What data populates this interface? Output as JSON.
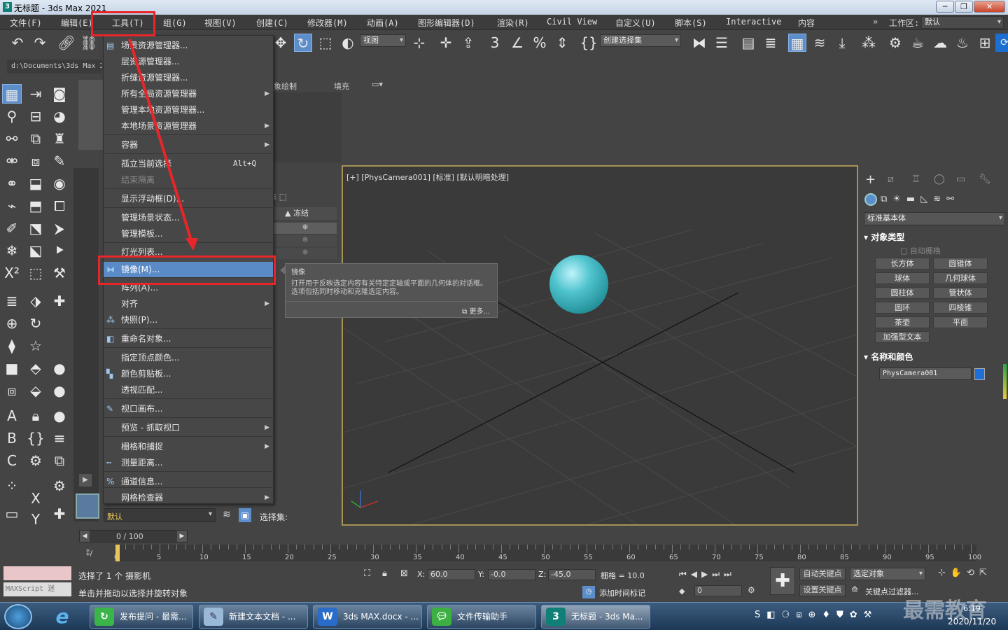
{
  "window": {
    "title": "无标题 - 3ds Max 2021",
    "logo": "3"
  },
  "menubar": {
    "items": [
      "文件(F)",
      "编辑(E)",
      "工具(T)",
      "组(G)",
      "视图(V)",
      "创建(C)",
      "修改器(M)",
      "动画(A)",
      "图形编辑器(D)",
      "渲染(R)",
      "Civil View",
      "自定义(U)",
      "脚本(S)",
      "Interactive",
      "内容"
    ],
    "workspace_label": "工作区:",
    "workspace_value": "默认"
  },
  "toolbar": {
    "view_dropdown": "视图",
    "selection_set": "创建选择集"
  },
  "path": "d:\\Documents\\3ds Max 2",
  "ribbon": {
    "paint": "象绘制",
    "fill": "填充"
  },
  "scene": {
    "freeze_header": "▲ 冻结"
  },
  "tools_menu": {
    "items": [
      {
        "label": "场景资源管理器...",
        "icon": "scene-explorer-icon"
      },
      {
        "label": "层资源管理器...",
        "icon": ""
      },
      {
        "label": "折缝资源管理器...",
        "icon": ""
      },
      {
        "label": "所有全局资源管理器",
        "icon": "",
        "submenu": true
      },
      {
        "label": "管理本地资源管理器...",
        "icon": ""
      },
      {
        "label": "本地场景资源管理器",
        "icon": "",
        "submenu": true
      },
      {
        "label": "容器",
        "icon": "",
        "submenu": true
      },
      {
        "label": "孤立当前选择",
        "icon": "",
        "shortcut": "Alt+Q"
      },
      {
        "label": "结束隔离",
        "icon": "",
        "disabled": true
      },
      {
        "label": "显示浮动框(D)...",
        "icon": ""
      },
      {
        "label": "管理场景状态...",
        "icon": ""
      },
      {
        "label": "管理模板...",
        "icon": ""
      },
      {
        "label": "灯光列表...",
        "icon": ""
      },
      {
        "label": "镜像(M)...",
        "icon": "mirror-icon",
        "highlighted": true
      },
      {
        "label": "阵列(A)...",
        "icon": ""
      },
      {
        "label": "对齐",
        "icon": "",
        "submenu": true
      },
      {
        "label": "快照(P)...",
        "icon": "snapshot-icon"
      },
      {
        "label": "重命名对象...",
        "icon": "rename-icon"
      },
      {
        "label": "指定顶点颜色...",
        "icon": ""
      },
      {
        "label": "颜色剪贴板...",
        "icon": "color-clipboard-icon"
      },
      {
        "label": "透视匹配...",
        "icon": ""
      },
      {
        "label": "视口画布...",
        "icon": "brush-icon"
      },
      {
        "label": "预览 - 抓取视口",
        "icon": "",
        "submenu": true
      },
      {
        "label": "栅格和捕捉",
        "icon": "",
        "submenu": true
      },
      {
        "label": "测量距离...",
        "icon": "measure-icon"
      },
      {
        "label": "通道信息...",
        "icon": "channel-icon"
      },
      {
        "label": "网格检查器",
        "icon": "",
        "submenu": true
      }
    ]
  },
  "tooltip": {
    "title": "镜像",
    "desc": "打开用于反映选定内容有关特定定轴或平面的几何体的对话框。选项包括同时移动和克隆选定内容。",
    "more": "更多..."
  },
  "viewport": {
    "label": "[+] [PhysCamera001] [标准] [默认明暗处理]"
  },
  "command_panel": {
    "category": "标准基本体",
    "object_type_title": "对象类型",
    "autogrid": "自动栅格",
    "buttons": [
      "长方体",
      "圆锥体",
      "球体",
      "几何球体",
      "圆柱体",
      "管状体",
      "圆环",
      "四棱锥",
      "茶壶",
      "平面"
    ],
    "extra": "加强型文本",
    "name_color_title": "名称和颜色",
    "object_name": "PhysCamera001",
    "object_color": "#1e6fd8"
  },
  "layer_bar": {
    "layer": "默认",
    "selection_set": "选择集:"
  },
  "timeline": {
    "frame": "0 / 100",
    "ticks": [
      "0",
      "5",
      "10",
      "15",
      "20",
      "25",
      "30",
      "35",
      "40",
      "45",
      "50",
      "55",
      "60",
      "65",
      "70",
      "75",
      "80",
      "85",
      "90",
      "95",
      "100"
    ]
  },
  "status": {
    "selected": "选择了 1 个 摄影机",
    "hint": "单击并拖动以选择并旋转对象",
    "maxscript": "MAXScript 迷",
    "x_label": "X:",
    "x": "60.0",
    "y_label": "Y:",
    "y": "-0.0",
    "z_label": "Z:",
    "z": "-45.0",
    "grid": "栅格 = 10.0",
    "add_time_tag": "添加时间标记",
    "auto_key": "自动关键点",
    "set_key": "设置关键点",
    "selected_obj": "选定对象",
    "key_filter": "关键点过滤器...",
    "frame_field": "0"
  },
  "taskbar": {
    "tasks": [
      "发布提问 - 最需...",
      "新建文本文档 - ...",
      "3ds MAX.docx - ...",
      "文件传输助手",
      "无标题 - 3ds Ma..."
    ],
    "time": "6:19",
    "date": "2020/11/20",
    "watermark": "最需教育"
  }
}
